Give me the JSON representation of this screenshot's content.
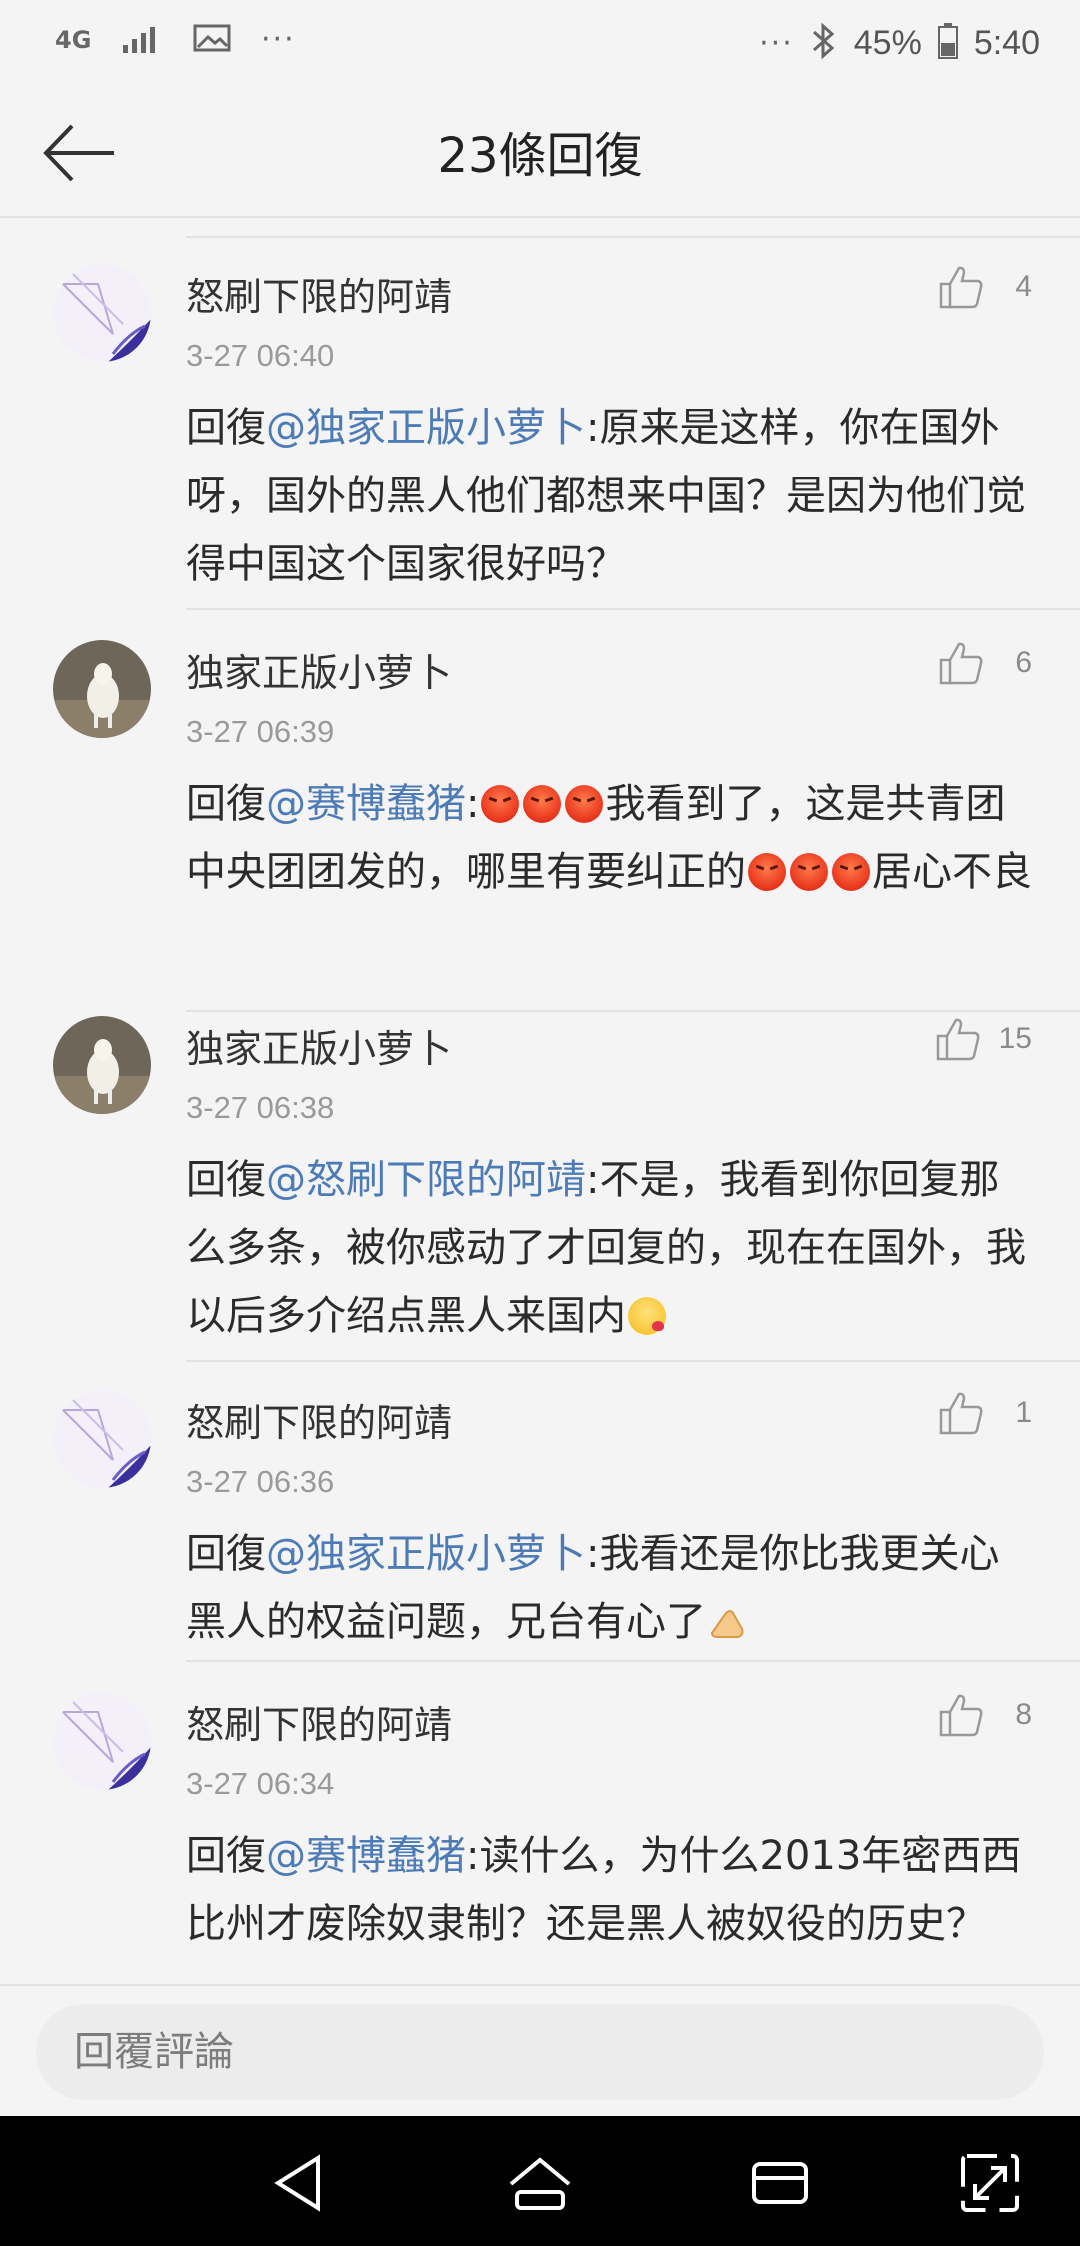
{
  "status_bar": {
    "network": "4G",
    "battery": "45%",
    "time": "5:40",
    "dots": "···"
  },
  "header": {
    "title": "23條回復"
  },
  "comments": [
    {
      "name": "怒刷下限的阿靖",
      "time": "3-27 06:40",
      "likes": "4",
      "reply_prefix": "回復",
      "mention": "@独家正版小萝卜",
      "text_1": ":原来是这样，你在国外呀，国外的黑人他们都想来中国？是因为他们觉得中国这个国家很好吗？",
      "avatar": "anime-avatar"
    },
    {
      "name": "独家正版小萝卜",
      "time": "3-27 06:39",
      "likes": "6",
      "reply_prefix": "回復",
      "mention": "@赛博蠢猪",
      "text_1": ":",
      "text_2": "我看到了，这是共青团中央团团发的，哪里有要纠正的",
      "text_3": "居心不良",
      "avatar": "goat-avatar"
    },
    {
      "name": "独家正版小萝卜",
      "time": "3-27 06:38",
      "likes": "15",
      "reply_prefix": "回復",
      "mention": "@怒刷下限的阿靖",
      "text_1": ":不是，我看到你回复那么多条，被你感动了才回复的，现在在国外，我以后多介绍点黑人来国内",
      "avatar": "goat-avatar"
    },
    {
      "name": "怒刷下限的阿靖",
      "time": "3-27 06:36",
      "likes": "1",
      "reply_prefix": "回復",
      "mention": "@独家正版小萝卜",
      "text_1": ":我看还是你比我更关心黑人的权益问题，兄台有心了",
      "avatar": "anime-avatar"
    },
    {
      "name": "怒刷下限的阿靖",
      "time": "3-27 06:34",
      "likes": "8",
      "reply_prefix": "回復",
      "mention": "@赛博蠢猪",
      "text_1": ":读什么，为什么2013年密西西比州才废除奴隶制？还是黑人被奴役的历史？",
      "avatar": "anime-avatar"
    }
  ],
  "reply_bar": {
    "placeholder": "回覆評論"
  },
  "colors": {
    "mention": "#4d7bb7",
    "background": "#f4f4f4"
  }
}
